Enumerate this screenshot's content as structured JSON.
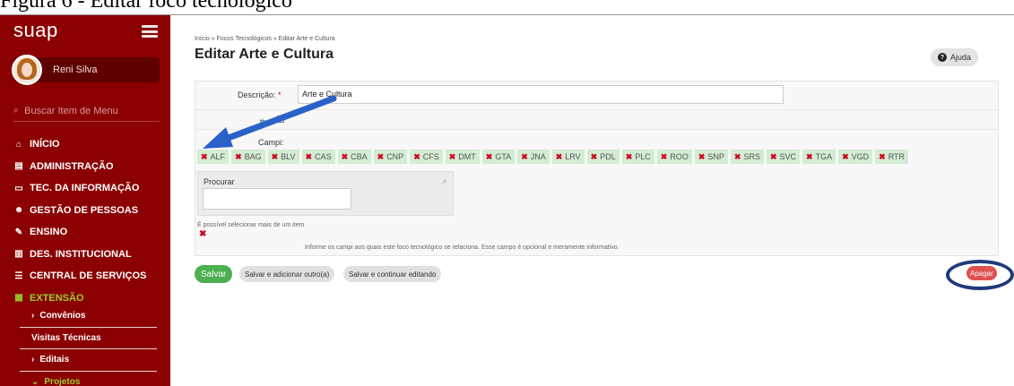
{
  "caption": "Figura 6 - Editar foco tecnológico",
  "sidebar": {
    "logo": "suap",
    "user_name": "Reni Silva",
    "search_placeholder": "Buscar Item de Menu",
    "menu": [
      {
        "label": "INÍCIO",
        "icon": "home-icon",
        "glyph": "⌂"
      },
      {
        "label": "ADMINISTRAÇÃO",
        "icon": "building-icon",
        "glyph": "▤"
      },
      {
        "label": "TEC. DA INFORMAÇÃO",
        "icon": "monitor-icon",
        "glyph": "▭"
      },
      {
        "label": "GESTÃO DE PESSOAS",
        "icon": "people-icon",
        "glyph": "☻"
      },
      {
        "label": "ENSINO",
        "icon": "pencil-icon",
        "glyph": "✎"
      },
      {
        "label": "DES. INSTITUCIONAL",
        "icon": "chart-icon",
        "glyph": "▥"
      },
      {
        "label": "CENTRAL DE SERVIÇOS",
        "icon": "list-icon",
        "glyph": "☰"
      },
      {
        "label": "EXTENSÃO",
        "icon": "briefcase-icon",
        "glyph": "▦"
      }
    ],
    "submenu": [
      {
        "label": "Convênios",
        "prefix": ">"
      },
      {
        "label": "Visitas Técnicas",
        "prefix": ""
      },
      {
        "label": "Editais",
        "prefix": ">"
      },
      {
        "label": "Projetos",
        "prefix": "v"
      }
    ]
  },
  "breadcrumb": "Início » Focos Tecnológicos » Editar Arte e Cultura",
  "page_title": "Editar Arte e Cultura",
  "help_label": "Ajuda",
  "form": {
    "descricao_label": "Descrição:",
    "required_mark": "*",
    "descricao_value": "Arte e Cultura",
    "ativo_label": "tivo",
    "ativo_checked": true,
    "campi_label": "Campi:",
    "campi": [
      "ALF",
      "BAG",
      "BLV",
      "CAS",
      "CBA",
      "CNP",
      "CFS",
      "DMT",
      "GTA",
      "JNA",
      "LRV",
      "PDL",
      "PLC",
      "ROO",
      "SNP",
      "SRS",
      "SVC",
      "TGA",
      "VGD",
      "RTR"
    ],
    "search_title": "Procurar",
    "help_text": "É possível selecionar mais de um item",
    "info_text": "Informe os campi aos quais este foco tecnológico se relaciona. Esse campo é opcional e meramente informativo."
  },
  "buttons": {
    "save": "Salvar",
    "save_add": "Salvar e adicionar outro(a)",
    "save_continue": "Salvar e continuar editando",
    "delete": "Apagar"
  },
  "colors": {
    "sidebar": "#8b0000",
    "tag_bg": "#d3ecd3",
    "save": "#4caf50",
    "delete": "#e05050",
    "annotation": "#1f3a7a"
  }
}
